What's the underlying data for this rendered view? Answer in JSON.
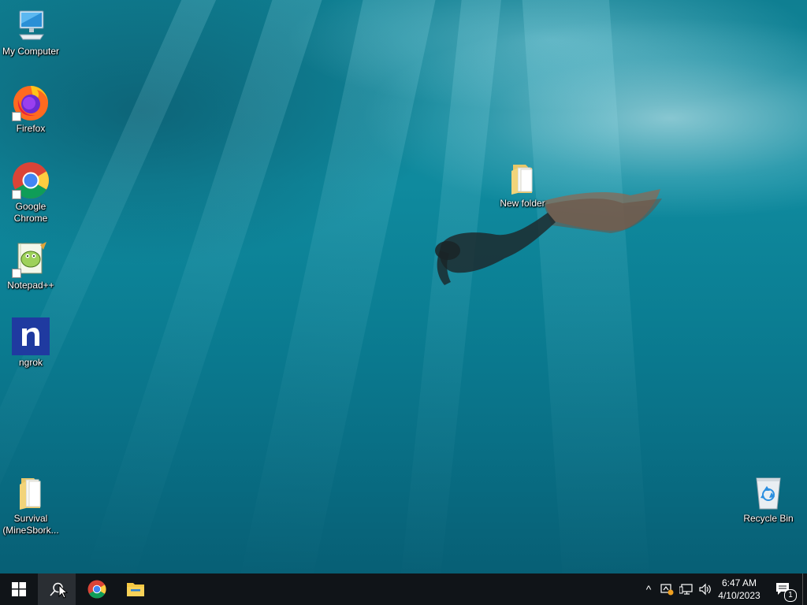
{
  "desktop": {
    "wallpaper": "underwater-freediver",
    "icons": {
      "my_computer": {
        "label": "My Computer",
        "icon": "computer-icon"
      },
      "firefox": {
        "label": "Firefox",
        "icon": "firefox-icon"
      },
      "chrome": {
        "label": "Google\nChrome",
        "icon": "chrome-icon"
      },
      "notepadpp": {
        "label": "Notepad++",
        "icon": "notepadpp-icon"
      },
      "ngrok": {
        "label": "ngrok",
        "icon": "ngrok-icon"
      },
      "survival": {
        "label": "Survival\n(MineSbork...",
        "icon": "folder-icon"
      },
      "new_folder": {
        "label": "New folder",
        "icon": "folder-icon"
      },
      "recycle_bin": {
        "label": "Recycle Bin",
        "icon": "recycle-bin-icon"
      }
    }
  },
  "taskbar": {
    "start": {
      "icon": "windows-start-icon"
    },
    "search": {
      "icon": "search-icon"
    },
    "pinned": [
      {
        "name": "Google Chrome",
        "icon": "chrome-icon"
      },
      {
        "name": "File Explorer",
        "icon": "file-explorer-icon"
      }
    ],
    "tray": {
      "chevron": "^",
      "icons": [
        "tray-warning-icon",
        "network-icon",
        "volume-icon"
      ],
      "clock_time": "6:47 AM",
      "clock_date": "4/10/2023",
      "notifications_count": "1"
    }
  },
  "colors": {
    "taskbar": "#101418",
    "accent": "#0078d7",
    "ngrok": "#1f3aa0"
  }
}
